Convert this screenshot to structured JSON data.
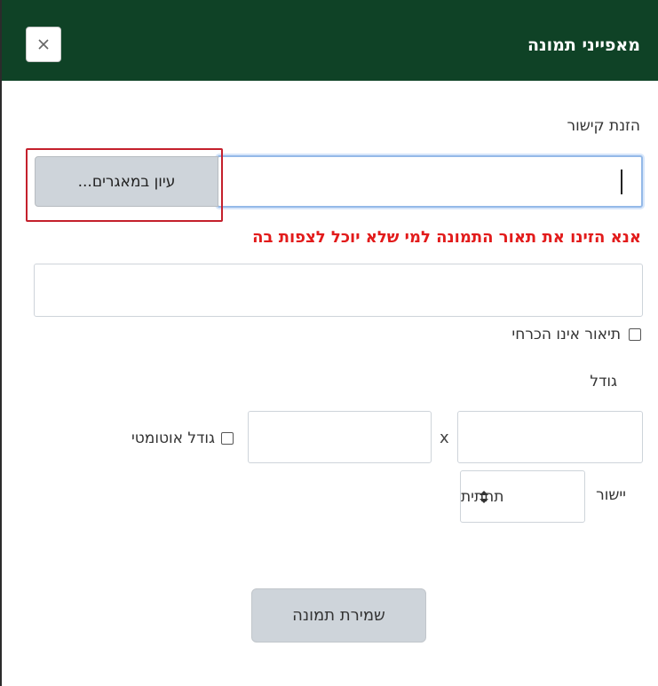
{
  "dialog": {
    "title": "מאפייני תמונה",
    "close_icon": "close-icon",
    "header_color": "#0f4226"
  },
  "url": {
    "label": "הזנת קישור",
    "value": "",
    "browse_label": "עיון במאגרים..."
  },
  "description": {
    "warning": "אנא הזינו את תאור התמונה למי שלא יוכל לצפות בה",
    "value": "",
    "not_required_label": "תיאור אינו הכרחי",
    "not_required_checked": false
  },
  "size": {
    "label": "גודל",
    "width_value": "",
    "separator": "x",
    "height_value": "",
    "auto_label": "גודל אוטומטי",
    "auto_checked": false
  },
  "alignment": {
    "label": "יישור",
    "selected": "תחתית"
  },
  "save": {
    "label": "שמירת תמונה"
  },
  "colors": {
    "warning": "#e21b1b",
    "highlight": "#c4202c",
    "focus_border": "#94b9e8"
  }
}
